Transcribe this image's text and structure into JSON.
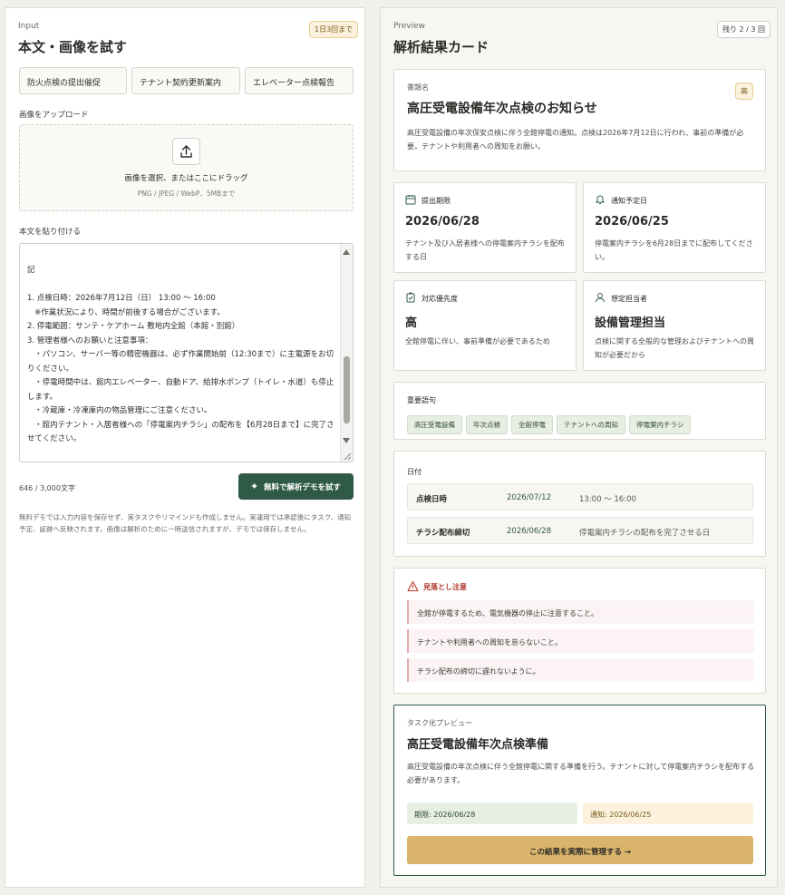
{
  "input": {
    "eyebrow": "Input",
    "title": "本文・画像を試す",
    "limit_badge": "1日3回まで",
    "samples": [
      "防火点検の提出催促",
      "テナント契約更新案内",
      "エレベーター点検報告"
    ],
    "upload_label": "画像をアップロード",
    "upload_main": "画像を選択、またはここにドラッグ",
    "upload_sub": "PNG / JPEG / WebP、5MBまで",
    "paste_label": "本文を貼り付ける",
    "textarea_value": "記\n\n1. 点検日時：2026年7月12日（日） 13:00 〜 16:00\n   ※作業状況により、時間が前後する場合がございます。\n2. 停電範囲：サンテ・ケアホーム 敷地内全館（本館・別館）\n3. 管理者様へのお願いと注意事項：\n   ・パソコン、サーバー等の精密機器は、必ず作業開始前（12:30まで）に主電源をお切りください。\n   ・停電時間中は、館内エレベーター、自動ドア、給排水ポンプ（トイレ・水道）も停止します。\n   ・冷蔵庫・冷凍庫内の物品管理にご注意ください。\n   ・館内テナント・入居者様への「停電案内チラシ」の配布を【6月28日まで】に完了させてください。",
    "char_count": "646 / 3,000文字",
    "demo_button": "無料で解析デモを試す",
    "note": "無料デモでは入力内容を保存せず、実タスクやリマインドも作成しません。実運用では承認後にタスク、通知予定、証跡へ反映されます。画像は解析のために一時送信されますが、デモでは保存しません。"
  },
  "preview": {
    "eyebrow": "Preview",
    "title": "解析結果カード",
    "remaining_badge": "残り 2 / 3 回",
    "doc": {
      "label": "書類名",
      "priority_badge": "高",
      "title": "高圧受電設備年次点検のお知らせ",
      "summary": "高圧受電設備の年次保安点検に伴う全館停電の通知。点検は2026年7月12日に行われ、事前の準備が必要。テナントや利用者への周知をお願い。"
    },
    "fields": [
      {
        "icon": "calendar-icon",
        "label": "提出期限",
        "value": "2026/06/28",
        "desc": "テナント及び入居者様への停電案内チラシを配布する日"
      },
      {
        "icon": "bell-icon",
        "label": "通知予定日",
        "value": "2026/06/25",
        "desc": "停電案内チラシを6月28日までに配布してください。"
      },
      {
        "icon": "clipboard-check-icon",
        "label": "対応優先度",
        "value": "高",
        "desc": "全館停電に伴い、事前準備が必要であるため"
      },
      {
        "icon": "user-icon",
        "label": "想定担当者",
        "value": "設備管理担当",
        "desc": "点検に関する全般的な管理およびテナントへの周知が必要だから"
      }
    ],
    "keywords_label": "重要語句",
    "keywords": [
      "高圧受電設備",
      "年次点検",
      "全館停電",
      "テナントへの周知",
      "停電案内チラシ"
    ],
    "dates_label": "日付",
    "dates": [
      {
        "name": "点検日時",
        "date": "2026/07/12",
        "note": "13:00 〜 16:00"
      },
      {
        "name": "チラシ配布締切",
        "date": "2026/06/28",
        "note": "停電案内チラシの配布を完了させる日"
      }
    ],
    "warnings_label": "見落とし注意",
    "warnings": [
      "全館が停電するため、電気機器の停止に注意すること。",
      "テナントや利用者への周知を怠らないこと。",
      "チラシ配布の締切に遅れないように。"
    ],
    "task": {
      "label": "タスク化プレビュー",
      "title": "高圧受電設備年次点検準備",
      "desc": "高圧受電設備の年次点検に伴う全館停電に関する準備を行う。テナントに対して停電案内チラシを配布する必要があります。",
      "deadline": "期限: 2026/06/28",
      "notify": "通知: 2026/06/25",
      "cta": "この結果を実際に管理する →"
    }
  },
  "colors": {
    "accent": "#2f5a47",
    "cta": "#d9b46a",
    "warn": "#c0392b"
  }
}
